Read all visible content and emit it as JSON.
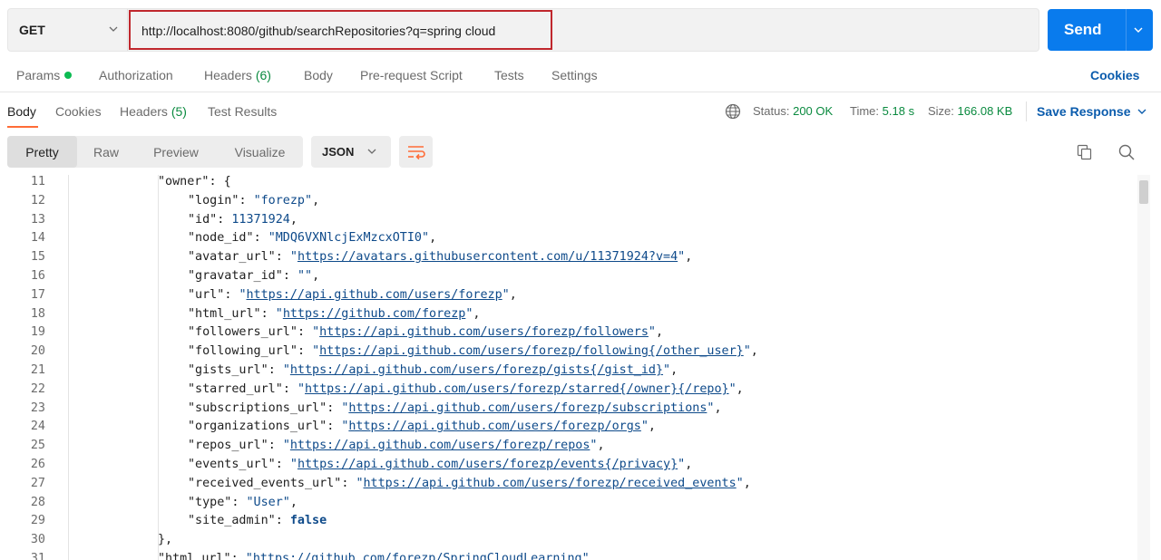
{
  "request": {
    "method": "GET",
    "url": "http://localhost:8080/github/searchRepositories?q=spring cloud",
    "send_label": "Send"
  },
  "request_tabs": [
    {
      "label": "Params",
      "has_dot": true
    },
    {
      "label": "Authorization"
    },
    {
      "label": "Headers",
      "count": "(6)"
    },
    {
      "label": "Body"
    },
    {
      "label": "Pre-request Script"
    },
    {
      "label": "Tests"
    },
    {
      "label": "Settings"
    }
  ],
  "cookies_link": "Cookies",
  "response_tabs": [
    {
      "label": "Body",
      "active": true
    },
    {
      "label": "Cookies"
    },
    {
      "label": "Headers",
      "count": "(5)"
    },
    {
      "label": "Test Results"
    }
  ],
  "status": {
    "status_label": "Status:",
    "status_value": "200 OK",
    "time_label": "Time:",
    "time_value": "5.18 s",
    "size_label": "Size:",
    "size_value": "166.08 KB"
  },
  "save_response": "Save Response",
  "view_modes": [
    "Pretty",
    "Raw",
    "Preview",
    "Visualize"
  ],
  "active_view": "Pretty",
  "format": "JSON",
  "colors": {
    "accent": "#ff6c37",
    "send": "#097bed",
    "url_highlight": "#c0272d",
    "status_ok": "#0a8a3f"
  },
  "code_lines": [
    {
      "n": "11",
      "indent": 1,
      "key": "owner",
      "open": "{"
    },
    {
      "n": "12",
      "indent": 2,
      "key": "login",
      "str": "forezp",
      "comma": true
    },
    {
      "n": "13",
      "indent": 2,
      "key": "id",
      "num": "11371924",
      "comma": true
    },
    {
      "n": "14",
      "indent": 2,
      "key": "node_id",
      "str": "MDQ6VXNlcjExMzcxOTI0",
      "comma": true
    },
    {
      "n": "15",
      "indent": 2,
      "key": "avatar_url",
      "url": "https://avatars.githubusercontent.com/u/11371924?v=4",
      "comma": true
    },
    {
      "n": "16",
      "indent": 2,
      "key": "gravatar_id",
      "str": "",
      "comma": true
    },
    {
      "n": "17",
      "indent": 2,
      "key": "url",
      "url": "https://api.github.com/users/forezp",
      "comma": true
    },
    {
      "n": "18",
      "indent": 2,
      "key": "html_url",
      "url": "https://github.com/forezp",
      "comma": true
    },
    {
      "n": "19",
      "indent": 2,
      "key": "followers_url",
      "url": "https://api.github.com/users/forezp/followers",
      "comma": true
    },
    {
      "n": "20",
      "indent": 2,
      "key": "following_url",
      "url": "https://api.github.com/users/forezp/following{/other_user}",
      "comma": true
    },
    {
      "n": "21",
      "indent": 2,
      "key": "gists_url",
      "url": "https://api.github.com/users/forezp/gists{/gist_id}",
      "comma": true
    },
    {
      "n": "22",
      "indent": 2,
      "key": "starred_url",
      "url": "https://api.github.com/users/forezp/starred{/owner}{/repo}",
      "comma": true
    },
    {
      "n": "23",
      "indent": 2,
      "key": "subscriptions_url",
      "url": "https://api.github.com/users/forezp/subscriptions",
      "comma": true
    },
    {
      "n": "24",
      "indent": 2,
      "key": "organizations_url",
      "url": "https://api.github.com/users/forezp/orgs",
      "comma": true
    },
    {
      "n": "25",
      "indent": 2,
      "key": "repos_url",
      "url": "https://api.github.com/users/forezp/repos",
      "comma": true
    },
    {
      "n": "26",
      "indent": 2,
      "key": "events_url",
      "url": "https://api.github.com/users/forezp/events{/privacy}",
      "comma": true
    },
    {
      "n": "27",
      "indent": 2,
      "key": "received_events_url",
      "url": "https://api.github.com/users/forezp/received_events",
      "comma": true
    },
    {
      "n": "28",
      "indent": 2,
      "key": "type",
      "str": "User",
      "comma": true
    },
    {
      "n": "29",
      "indent": 2,
      "key": "site_admin",
      "bool": "false"
    },
    {
      "n": "30",
      "indent": 1,
      "close": "},"
    },
    {
      "n": "31",
      "indent": 1,
      "key": "html_url",
      "url": "https://github.com/forezp/SpringCloudLearning",
      "comma": true
    }
  ]
}
